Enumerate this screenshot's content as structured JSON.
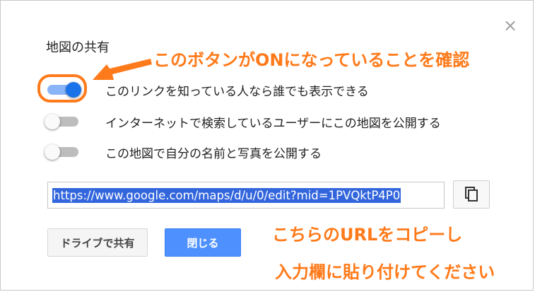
{
  "dialog": {
    "title": "地図の共有",
    "close_icon": "×",
    "toggles": [
      {
        "label": "このリンクを知っている人なら誰でも表示できる",
        "state": "on"
      },
      {
        "label": "インターネットで検索しているユーザーにこの地図を公開する",
        "state": "off"
      },
      {
        "label": "この地図で自分の名前と写真を公開する",
        "state": "off"
      }
    ],
    "url": "https://www.google.com/maps/d/u/0/edit?mid=1PVQktP4P0",
    "copy_icon": "copy-icon",
    "buttons": {
      "drive_share": "ドライブで共有",
      "close": "閉じる"
    }
  },
  "annotations": {
    "top": "このボタンがONになっていることを確認",
    "bottom_line1": "こちらのURLをコピーし",
    "bottom_line2": "入力欄に貼り付けてください"
  },
  "colors": {
    "annotation": "#ff7a1a",
    "toggle_on_knob": "#1a73e8",
    "toggle_on_track": "#8ab4f8",
    "toggle_off_track": "#bdbdbd",
    "primary_button": "#4d90fe",
    "url_selection": "#3366dd"
  }
}
